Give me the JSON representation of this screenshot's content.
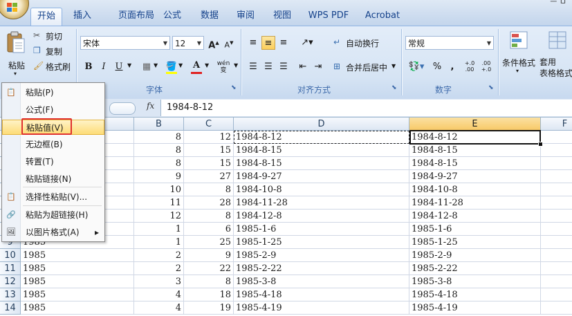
{
  "tabs": [
    "开始",
    "插入",
    "页面布局",
    "公式",
    "数据",
    "审阅",
    "视图",
    "WPS PDF",
    "Acrobat"
  ],
  "window_controls": "ㅡ ㅁ",
  "clipboard": {
    "paste": "粘贴",
    "cut": "剪切",
    "copy": "复制",
    "format_painter": "格式刷"
  },
  "font": {
    "name": "宋体",
    "size": "12",
    "label": "字体",
    "bold": "B",
    "italic": "I",
    "underline": "U",
    "grow": "A",
    "shrink": "A",
    "font_color": "A",
    "phonetic": "wén"
  },
  "alignment": {
    "wrap": "自动换行",
    "merge": "合并后居中",
    "label": "对齐方式"
  },
  "number": {
    "format": "常规",
    "label": "数字",
    "percent": "%",
    "comma": ",",
    "inc_decimal": "+.0 .00",
    "dec_decimal": ".00 +.0"
  },
  "styles": {
    "conditional": "条件格式",
    "table": "套用\n表格格式"
  },
  "formula_bar": {
    "fx": "fx",
    "value": "1984-8-12"
  },
  "columns": [
    "B",
    "C",
    "D",
    "E",
    "F"
  ],
  "rows": [
    {
      "n": "",
      "a": "",
      "b": "8",
      "c": "12",
      "d": "1984-8-12",
      "e": "1984-8-12"
    },
    {
      "n": "",
      "a": "",
      "b": "8",
      "c": "15",
      "d": "1984-8-15",
      "e": "1984-8-15"
    },
    {
      "n": "",
      "a": "",
      "b": "8",
      "c": "15",
      "d": "1984-8-15",
      "e": "1984-8-15"
    },
    {
      "n": "",
      "a": "",
      "b": "9",
      "c": "27",
      "d": "1984-9-27",
      "e": "1984-9-27"
    },
    {
      "n": "",
      "a": "",
      "b": "10",
      "c": "8",
      "d": "1984-10-8",
      "e": "1984-10-8"
    },
    {
      "n": "",
      "a": "",
      "b": "11",
      "c": "28",
      "d": "1984-11-28",
      "e": "1984-11-28"
    },
    {
      "n": "",
      "a": "",
      "b": "12",
      "c": "8",
      "d": "1984-12-8",
      "e": "1984-12-8"
    },
    {
      "n": "",
      "a": "",
      "b": "1",
      "c": "6",
      "d": "1985-1-6",
      "e": "1985-1-6"
    },
    {
      "n": "9",
      "a": "1985",
      "b": "1",
      "c": "25",
      "d": "1985-1-25",
      "e": "1985-1-25"
    },
    {
      "n": "10",
      "a": "1985",
      "b": "2",
      "c": "9",
      "d": "1985-2-9",
      "e": "1985-2-9"
    },
    {
      "n": "11",
      "a": "1985",
      "b": "2",
      "c": "22",
      "d": "1985-2-22",
      "e": "1985-2-22"
    },
    {
      "n": "12",
      "a": "1985",
      "b": "3",
      "c": "8",
      "d": "1985-3-8",
      "e": "1985-3-8"
    },
    {
      "n": "13",
      "a": "1985",
      "b": "4",
      "c": "18",
      "d": "1985-4-18",
      "e": "1985-4-18"
    },
    {
      "n": "14",
      "a": "1985",
      "b": "4",
      "c": "19",
      "d": "1985-4-19",
      "e": "1985-4-19"
    }
  ],
  "context_menu": [
    {
      "label": "粘贴(P)",
      "icon": "paste-icon"
    },
    {
      "label": "公式(F)",
      "icon": ""
    },
    {
      "label": "粘贴值(V)",
      "icon": "",
      "highlighted": true
    },
    {
      "label": "无边框(B)",
      "icon": ""
    },
    {
      "label": "转置(T)",
      "icon": ""
    },
    {
      "label": "粘贴链接(N)",
      "icon": ""
    },
    {
      "label": "选择性粘贴(V)...",
      "icon": "paste-special-icon"
    },
    {
      "label": "粘贴为超链接(H)",
      "icon": "paste-hyperlink-icon"
    },
    {
      "label": "以图片格式(A)",
      "icon": "picture-icon",
      "submenu": true
    }
  ],
  "colors": {
    "accent": "#15428b",
    "highlight": "#fddc77",
    "annotation_red": "#e0302f",
    "selected_header": "#f8c968"
  }
}
